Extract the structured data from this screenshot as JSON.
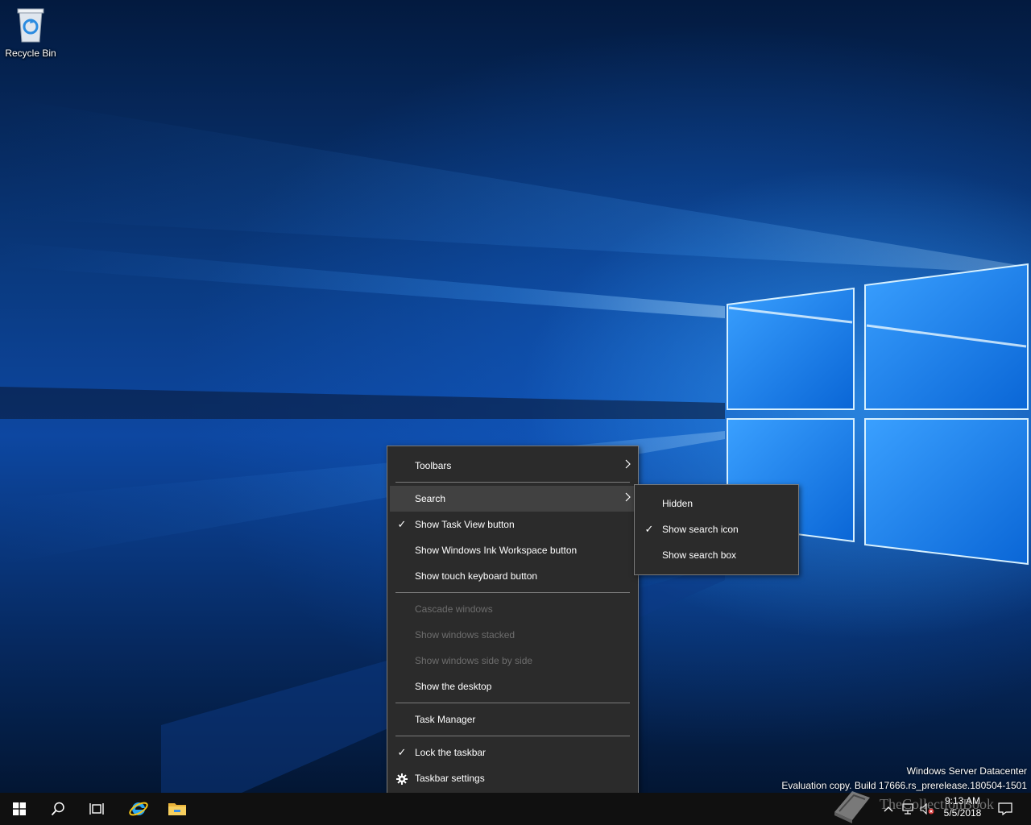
{
  "desktop": {
    "icons": [
      {
        "label": "Recycle Bin",
        "icon": "recycle-bin-icon"
      }
    ],
    "watermark": {
      "line1": "Windows Server Datacenter",
      "line2": "Evaluation copy. Build 17666.rs_prerelease.180504-1501"
    }
  },
  "context_menu": {
    "items": [
      {
        "label": "Toolbars",
        "submenu": true
      },
      {
        "label": "Search",
        "submenu": true,
        "highlighted": true
      },
      {
        "label": "Show Task View button",
        "checked": true
      },
      {
        "label": "Show Windows Ink Workspace button"
      },
      {
        "label": "Show touch keyboard button"
      },
      {
        "label": "Cascade windows",
        "disabled": true
      },
      {
        "label": "Show windows stacked",
        "disabled": true
      },
      {
        "label": "Show windows side by side",
        "disabled": true
      },
      {
        "label": "Show the desktop"
      },
      {
        "label": "Task Manager"
      },
      {
        "label": "Lock the taskbar",
        "checked": true
      },
      {
        "label": "Taskbar settings",
        "icon": "gear-icon"
      }
    ],
    "check_glyph": "✓",
    "arrow_glyph": "›"
  },
  "search_submenu": {
    "items": [
      {
        "label": "Hidden"
      },
      {
        "label": "Show search icon",
        "checked": true
      },
      {
        "label": "Show search box"
      }
    ]
  },
  "taskbar": {
    "buttons": [
      "start-button",
      "search-button",
      "task-view-button",
      "internet-explorer-button",
      "file-explorer-button"
    ],
    "clock": {
      "time": "9:13 AM",
      "date": "5/5/2018"
    },
    "overlay_text": "TheCollectionBook"
  },
  "colors": {
    "menu_bg": "#2b2b2b",
    "menu_hover": "#414141",
    "menu_border": "#7a7a7a",
    "disabled_text": "#6d6d6d",
    "taskbar_bg": "#101010"
  }
}
